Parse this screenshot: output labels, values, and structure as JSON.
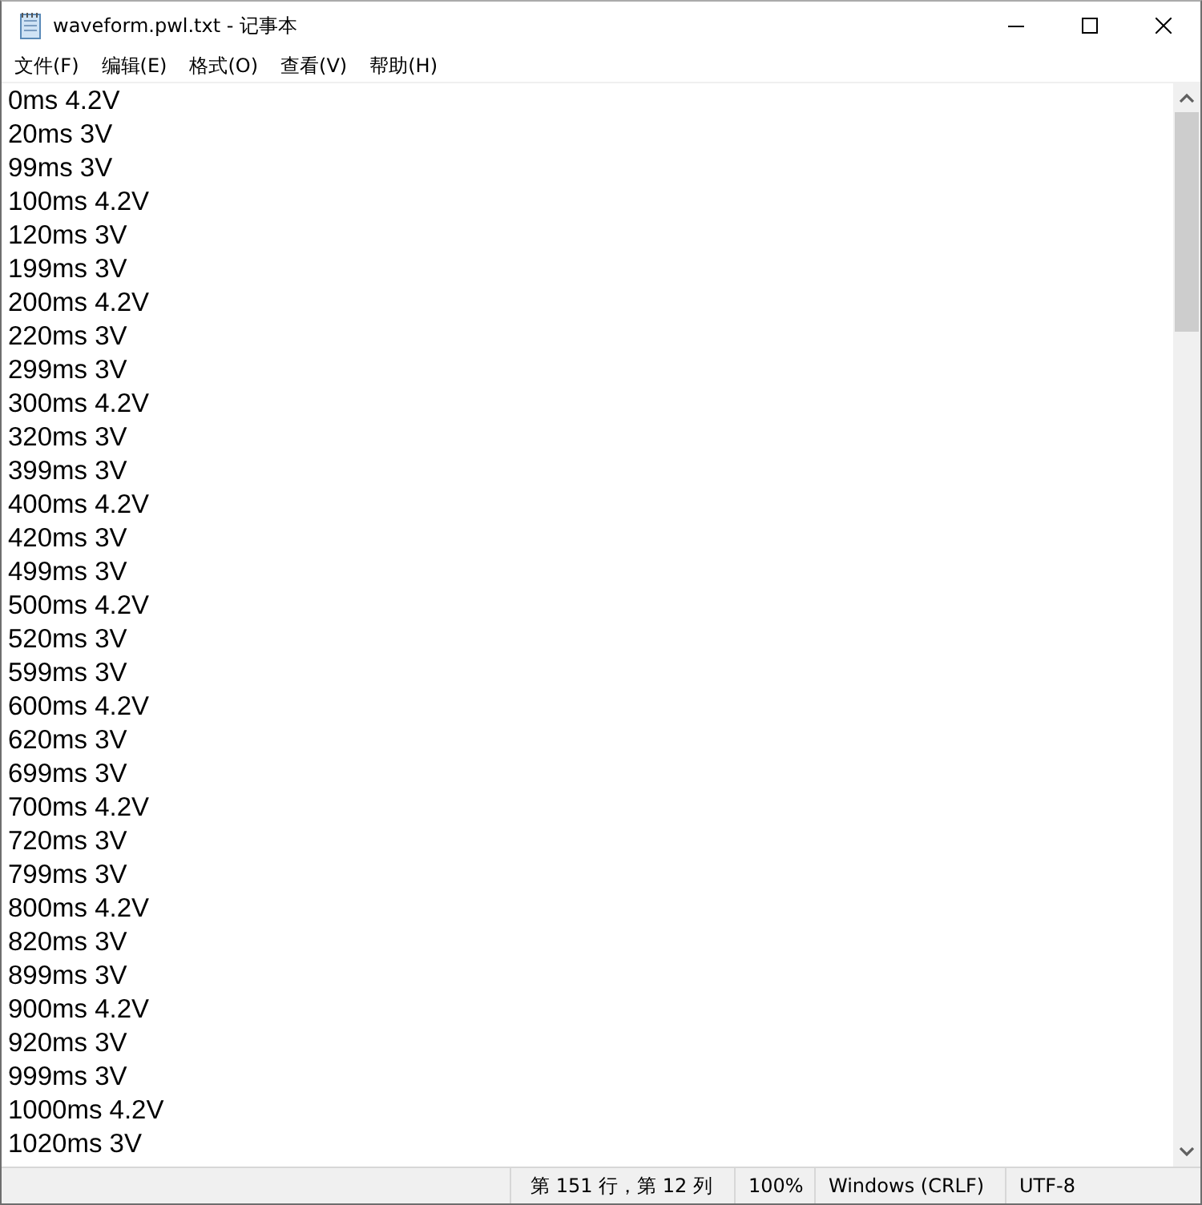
{
  "window": {
    "title": "waveform.pwl.txt - 记事本"
  },
  "menu": [
    "文件(F)",
    "编辑(E)",
    "格式(O)",
    "查看(V)",
    "帮助(H)"
  ],
  "lines": [
    "0ms 4.2V",
    "20ms 3V",
    "99ms 3V",
    "100ms 4.2V",
    "120ms 3V",
    "199ms 3V",
    "200ms 4.2V",
    "220ms 3V",
    "299ms 3V",
    "300ms 4.2V",
    "320ms 3V",
    "399ms 3V",
    "400ms 4.2V",
    "420ms 3V",
    "499ms 3V",
    "500ms 4.2V",
    "520ms 3V",
    "599ms 3V",
    "600ms 4.2V",
    "620ms 3V",
    "699ms 3V",
    "700ms 4.2V",
    "720ms 3V",
    "799ms 3V",
    "800ms 4.2V",
    "820ms 3V",
    "899ms 3V",
    "900ms 4.2V",
    "920ms 3V",
    "999ms 3V",
    "1000ms 4.2V",
    "1020ms 3V"
  ],
  "status_bar": {
    "position": "第 151 行，第 12 列",
    "zoom": "100%",
    "line_ending": "Windows (CRLF)",
    "encoding": "UTF-8"
  }
}
